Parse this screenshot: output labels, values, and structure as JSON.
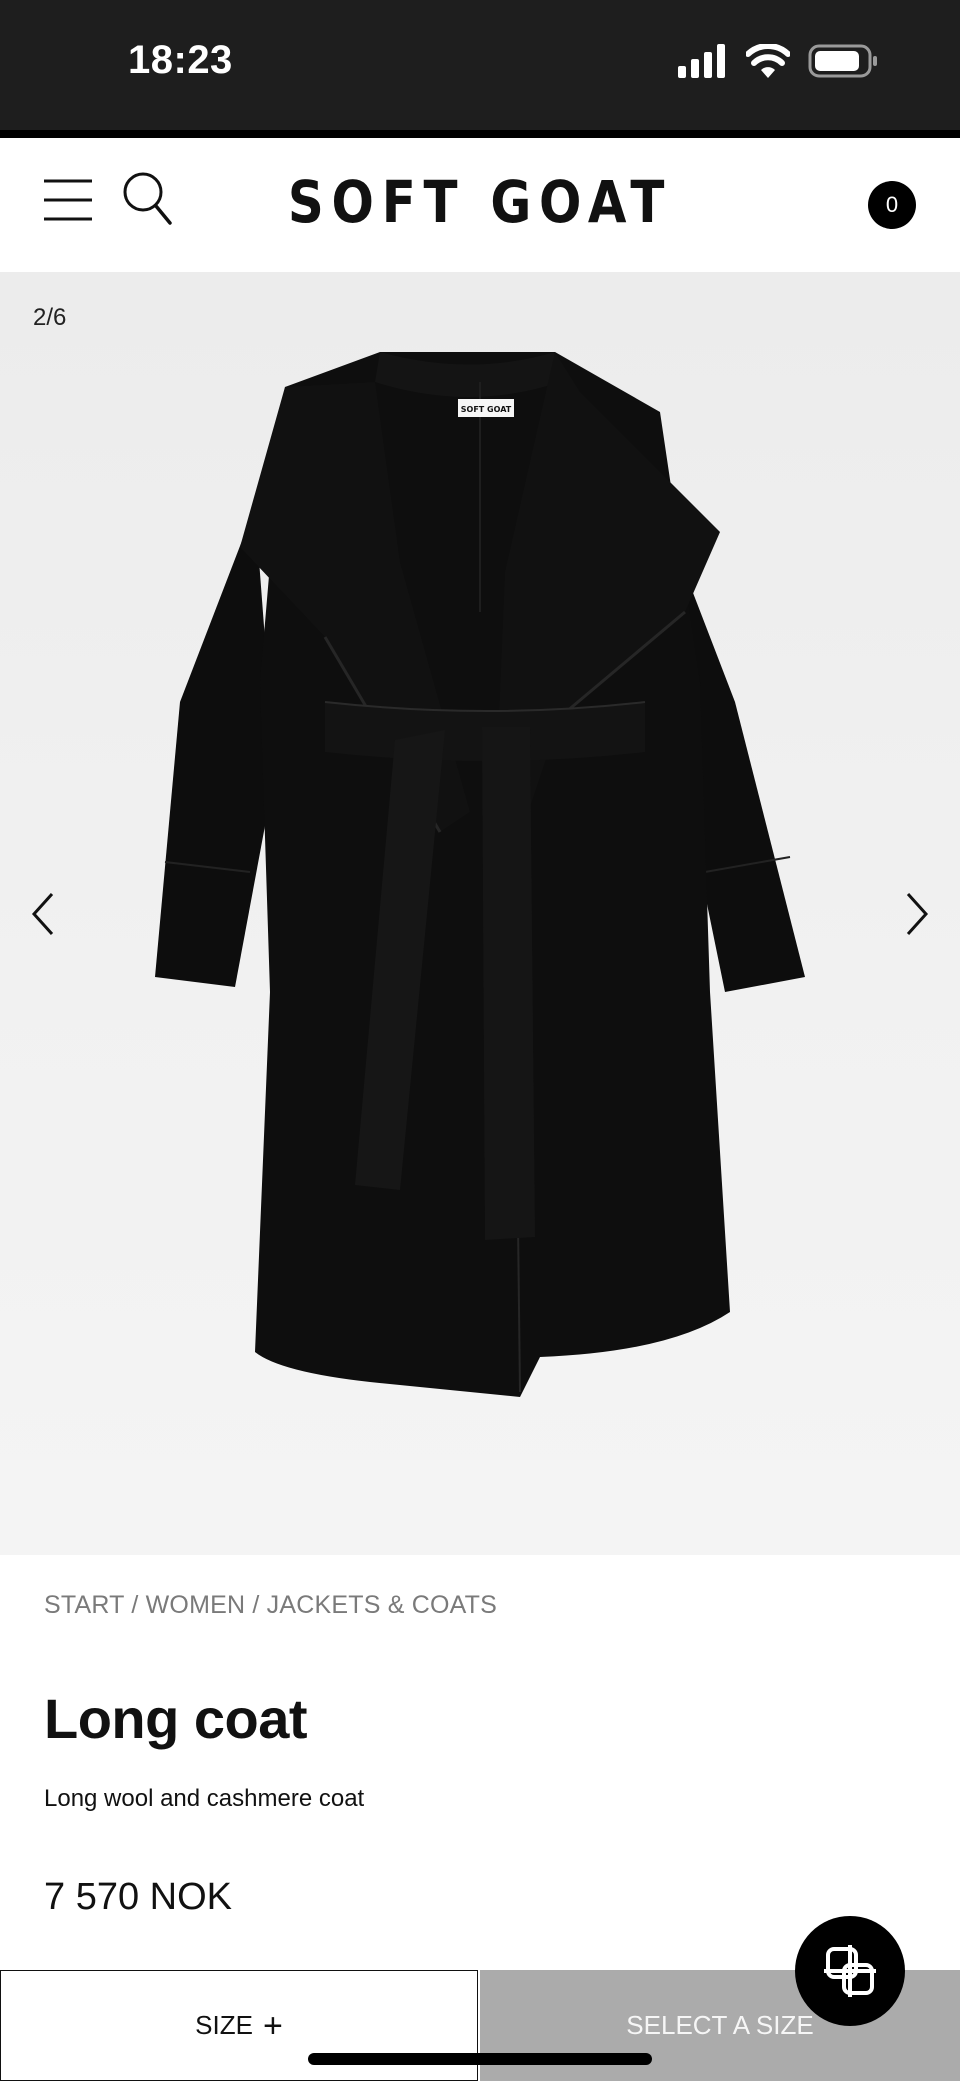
{
  "status_bar": {
    "time": "18:23"
  },
  "header": {
    "brand": "SOFT GOAT",
    "cart_count": "0"
  },
  "gallery": {
    "counter": "2/6",
    "label_text": "SOFT GOAT"
  },
  "product": {
    "breadcrumb": [
      "START",
      "WOMEN",
      "JACKETS & COATS"
    ],
    "breadcrumb_separator": " / ",
    "title": "Long coat",
    "description": "Long wool and cashmere coat",
    "price": "7 570 NOK"
  },
  "actions": {
    "size_label": "SIZE",
    "size_plus": "+",
    "select_label": "SELECT A SIZE"
  },
  "icons": {
    "signal": "signal-icon",
    "wifi": "wifi-icon",
    "battery": "battery-icon",
    "menu": "menu-icon",
    "search": "search-icon",
    "prev": "chevron-left-icon",
    "next": "chevron-right-icon",
    "chat": "chat-logo-icon"
  },
  "colors": {
    "status_bg": "#1e1e1e",
    "select_bg": "#ababab",
    "accent": "#000000"
  }
}
